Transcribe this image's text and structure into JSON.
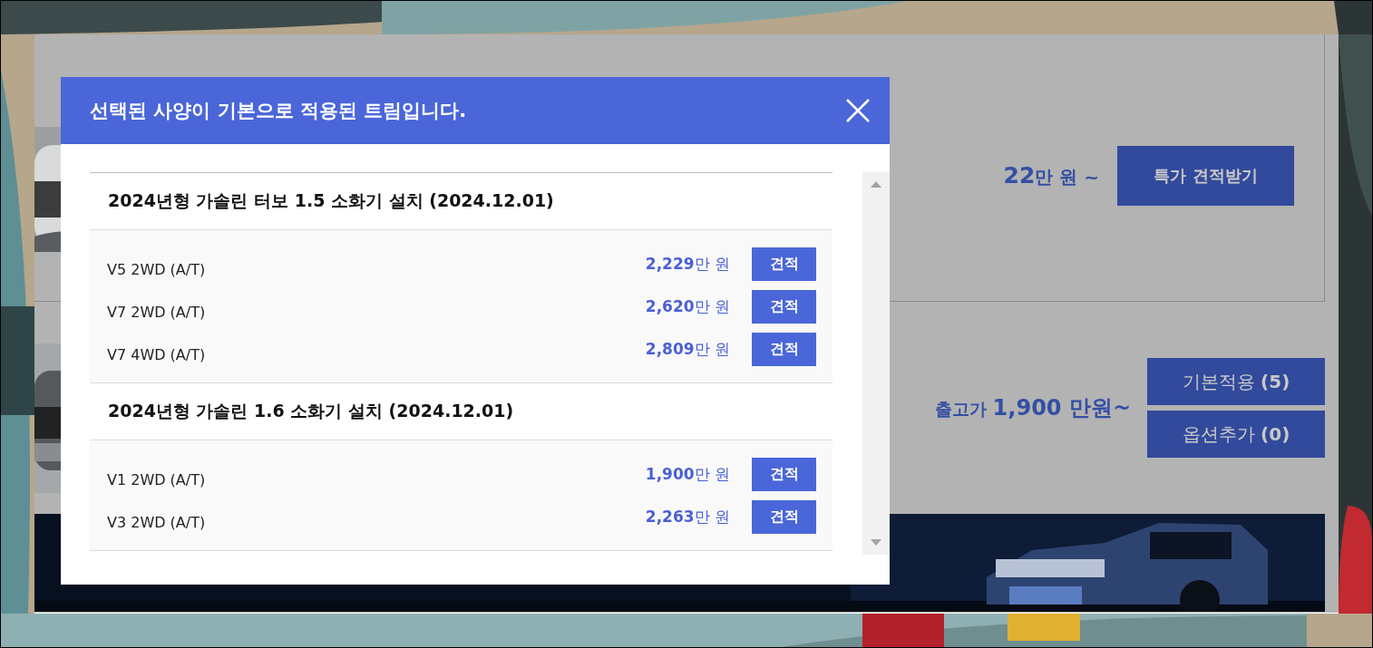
{
  "page": {
    "offer": {
      "price": "**22**만 원 ~",
      "button": "특가 견적받기"
    },
    "release": {
      "price": "출고가 **1,900 만원~**",
      "buttons": [
        "기본적용 **(5)**",
        "옵션추가 **(0)**"
      ]
    }
  },
  "modal": {
    "title": "선택된 사양이 기본으로 적용된 트림입니다.",
    "groups": [
      {
        "title": "2024년형 가솔린 터보 1.5 소화기 설치 (2024.12.01)",
        "trims": [
          {
            "name": "V5 2WD (A/T)",
            "price": "**2,229**만 원",
            "button": "견적"
          },
          {
            "name": "V7 2WD (A/T)",
            "price": "**2,620**만 원",
            "button": "견적"
          },
          {
            "name": "V7 4WD (A/T)",
            "price": "**2,809**만 원",
            "button": "견적"
          }
        ]
      },
      {
        "title": "2024년형 가솔린 1.6 소화기 설치 (2024.12.01)",
        "trims": [
          {
            "name": "V1 2WD (A/T)",
            "price": "**1,900**만 원",
            "button": "견적"
          },
          {
            "name": "V3 2WD (A/T)",
            "price": "**2,263**만 원",
            "button": "견적"
          }
        ]
      }
    ]
  }
}
